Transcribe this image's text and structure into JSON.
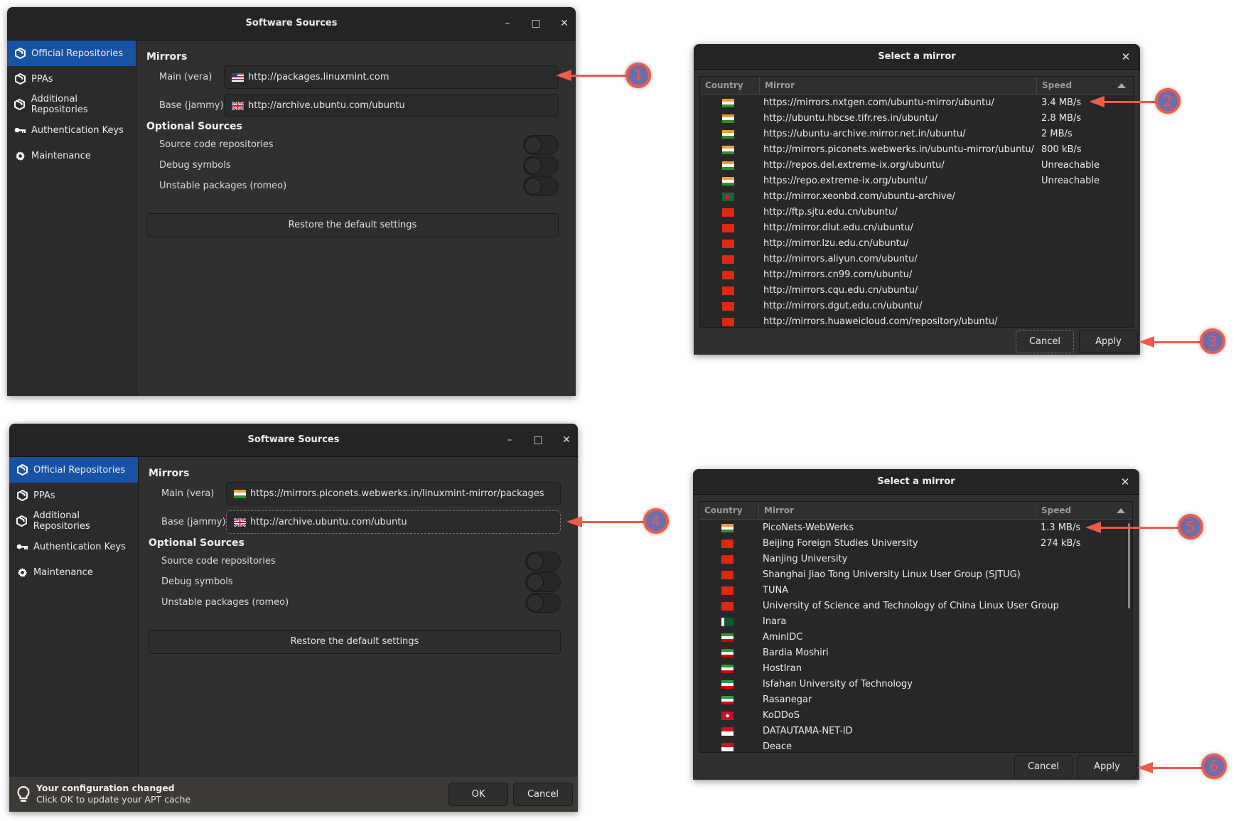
{
  "colors": {
    "accent_blue": "#1752a3",
    "annotation_red": "#ef5a4b",
    "annotation_purple": "#6c6dab"
  },
  "windows": [
    {
      "title": "Software Sources",
      "controls": {
        "minimize": "–",
        "maximize": "□",
        "close": "✕"
      },
      "sidebar": [
        {
          "label": "Official Repositories",
          "icon": "package-icon",
          "active": true
        },
        {
          "label": "PPAs",
          "icon": "package-icon"
        },
        {
          "label": "Additional Repositories",
          "icon": "package-icon"
        },
        {
          "label": "Authentication Keys",
          "icon": "key-icon"
        },
        {
          "label": "Maintenance",
          "icon": "gear-icon"
        }
      ],
      "mirrors_title": "Mirrors",
      "main_label": "Main (vera)",
      "main_value": "http://packages.linuxmint.com",
      "main_flag": "us",
      "base_label": "Base (jammy)",
      "base_value": "http://archive.ubuntu.com/ubuntu",
      "base_flag": "uk",
      "optional_title": "Optional Sources",
      "toggles": [
        {
          "label": "Source code repositories",
          "on": false
        },
        {
          "label": "Debug symbols",
          "on": false
        },
        {
          "label": "Unstable packages (romeo)",
          "on": false
        }
      ],
      "restore_label": "Restore the default settings"
    },
    {
      "title": "Software Sources",
      "controls": {
        "minimize": "–",
        "maximize": "□",
        "close": "✕"
      },
      "sidebar": [
        {
          "label": "Official Repositories",
          "icon": "package-icon",
          "active": true
        },
        {
          "label": "PPAs",
          "icon": "package-icon"
        },
        {
          "label": "Additional Repositories",
          "icon": "package-icon"
        },
        {
          "label": "Authentication Keys",
          "icon": "key-icon"
        },
        {
          "label": "Maintenance",
          "icon": "gear-icon"
        }
      ],
      "mirrors_title": "Mirrors",
      "main_label": "Main (vera)",
      "main_value": "https://mirrors.piconets.webwerks.in/linuxmint-mirror/packages",
      "main_flag": "in",
      "base_label": "Base (jammy)",
      "base_value": "http://archive.ubuntu.com/ubuntu",
      "base_flag": "uk",
      "optional_title": "Optional Sources",
      "toggles": [
        {
          "label": "Source code repositories",
          "on": false
        },
        {
          "label": "Debug symbols",
          "on": false
        },
        {
          "label": "Unstable packages (romeo)",
          "on": false
        }
      ],
      "restore_label": "Restore the default settings",
      "footer": {
        "title": "Your configuration changed",
        "subtitle": "Click OK to update your APT cache",
        "ok_label": "OK",
        "cancel_label": "Cancel"
      }
    }
  ],
  "dialogs": [
    {
      "title": "Select a mirror",
      "close": "✕",
      "columns": {
        "country": "Country",
        "mirror": "Mirror",
        "speed": "Speed"
      },
      "rows": [
        {
          "flag": "in",
          "mirror": "https://mirrors.nxtgen.com/ubuntu-mirror/ubuntu/",
          "speed": "3.4 MB/s"
        },
        {
          "flag": "in",
          "mirror": "http://ubuntu.hbcse.tifr.res.in/ubuntu/",
          "speed": "2.8 MB/s"
        },
        {
          "flag": "in",
          "mirror": "https://ubuntu-archive.mirror.net.in/ubuntu/",
          "speed": "2 MB/s"
        },
        {
          "flag": "in",
          "mirror": "http://mirrors.piconets.webwerks.in/ubuntu-mirror/ubuntu/",
          "speed": "800 kB/s"
        },
        {
          "flag": "in",
          "mirror": "http://repos.del.extreme-ix.org/ubuntu/",
          "speed": "Unreachable"
        },
        {
          "flag": "in",
          "mirror": "https://repo.extreme-ix.org/ubuntu/",
          "speed": "Unreachable"
        },
        {
          "flag": "bd",
          "mirror": "http://mirror.xeonbd.com/ubuntu-archive/",
          "speed": ""
        },
        {
          "flag": "cn",
          "mirror": "http://ftp.sjtu.edu.cn/ubuntu/",
          "speed": ""
        },
        {
          "flag": "cn",
          "mirror": "http://mirror.dlut.edu.cn/ubuntu/",
          "speed": ""
        },
        {
          "flag": "cn",
          "mirror": "http://mirror.lzu.edu.cn/ubuntu/",
          "speed": ""
        },
        {
          "flag": "cn",
          "mirror": "http://mirrors.aliyun.com/ubuntu/",
          "speed": ""
        },
        {
          "flag": "cn",
          "mirror": "http://mirrors.cn99.com/ubuntu/",
          "speed": ""
        },
        {
          "flag": "cn",
          "mirror": "http://mirrors.cqu.edu.cn/ubuntu/",
          "speed": ""
        },
        {
          "flag": "cn",
          "mirror": "http://mirrors.dgut.edu.cn/ubuntu/",
          "speed": ""
        },
        {
          "flag": "cn",
          "mirror": "http://mirrors.huaweicloud.com/repository/ubuntu/",
          "speed": ""
        }
      ],
      "cancel_label": "Cancel",
      "apply_label": "Apply"
    },
    {
      "title": "Select a mirror",
      "close": "✕",
      "columns": {
        "country": "Country",
        "mirror": "Mirror",
        "speed": "Speed"
      },
      "rows": [
        {
          "flag": "in",
          "mirror": "PicoNets-WebWerks",
          "speed": "1.3 MB/s"
        },
        {
          "flag": "cn",
          "mirror": "Beijing Foreign Studies University",
          "speed": "274 kB/s"
        },
        {
          "flag": "cn",
          "mirror": "Nanjing University",
          "speed": ""
        },
        {
          "flag": "cn",
          "mirror": "Shanghai Jiao Tong University Linux User Group (SJTUG)",
          "speed": ""
        },
        {
          "flag": "cn",
          "mirror": "TUNA",
          "speed": ""
        },
        {
          "flag": "cn",
          "mirror": "University of Science and Technology of China Linux User Group",
          "speed": ""
        },
        {
          "flag": "pk",
          "mirror": "Inara",
          "speed": ""
        },
        {
          "flag": "ir",
          "mirror": "AminIDC",
          "speed": ""
        },
        {
          "flag": "ir",
          "mirror": "Bardia Moshiri",
          "speed": ""
        },
        {
          "flag": "ir",
          "mirror": "HostIran",
          "speed": ""
        },
        {
          "flag": "ir",
          "mirror": "Isfahan University of Technology",
          "speed": ""
        },
        {
          "flag": "ir",
          "mirror": "Rasanegar",
          "speed": ""
        },
        {
          "flag": "hk",
          "mirror": "KoDDoS",
          "speed": ""
        },
        {
          "flag": "id",
          "mirror": "DATAUTAMA-NET-ID",
          "speed": ""
        },
        {
          "flag": "id",
          "mirror": "Deace",
          "speed": ""
        }
      ],
      "cancel_label": "Cancel",
      "apply_label": "Apply"
    }
  ],
  "annotations": [
    "1",
    "2",
    "3",
    "4",
    "5",
    "6"
  ]
}
